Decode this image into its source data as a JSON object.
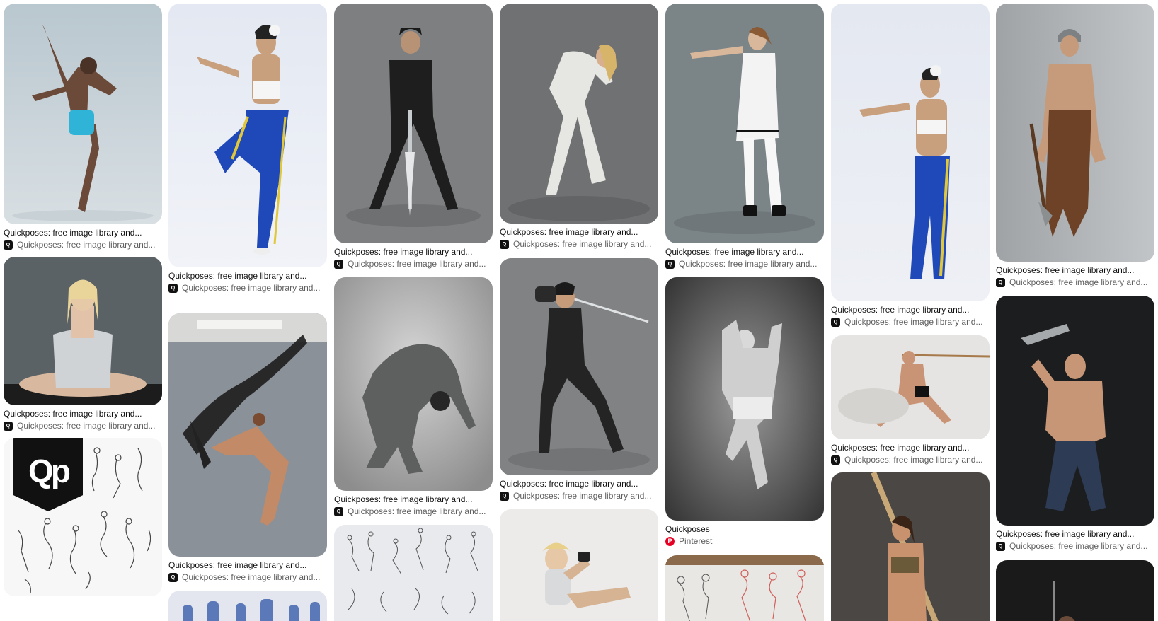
{
  "pins": [
    {
      "title": "Quickposes: free image library and...",
      "source": "Quickposes: free image library and...",
      "source_icon": "quickposes-logo-icon",
      "scene": "gray studio backdrop, man in blue shorts high kick"
    },
    {
      "title": "Quickposes: free image library and...",
      "source": "Quickposes: free image library and...",
      "source_icon": "quickposes-logo-icon",
      "scene": "woman meditating wrapped in towel"
    },
    {
      "title": "",
      "source": "",
      "source_icon": "",
      "scene": "gesture sketches sheet with logo",
      "logo_text": "Qp"
    },
    {
      "title": "Quickposes: free image library and...",
      "source": "Quickposes: free image library and...",
      "source_icon": "quickposes-logo-icon",
      "scene": "woman in blue leggings dancing pose"
    },
    {
      "title": "Quickposes: free image library and...",
      "source": "Quickposes: free image library and...",
      "source_icon": "quickposes-logo-icon",
      "scene": "dancer with black fabric"
    },
    {
      "title": "",
      "source": "",
      "source_icon": "",
      "scene": "blue figure sketches"
    },
    {
      "title": "Quickposes: free image library and...",
      "source": "Quickposes: free image library and...",
      "source_icon": "quickposes-logo-icon",
      "scene": "woman in black armor with sword"
    },
    {
      "title": "Quickposes: free image library and...",
      "source": "Quickposes: free image library and...",
      "source_icon": "quickposes-logo-icon",
      "scene": "man bending backwards"
    },
    {
      "title": "",
      "source": "",
      "source_icon": "",
      "scene": "gesture sketches"
    },
    {
      "title": "Quickposes: free image library and...",
      "source": "Quickposes: free image library and...",
      "source_icon": "quickposes-logo-icon",
      "scene": "woman in white dress bending"
    },
    {
      "title": "Quickposes: free image library and...",
      "source": "Quickposes: free image library and...",
      "source_icon": "quickposes-logo-icon",
      "scene": "woman with sword fighting stance"
    },
    {
      "title": "",
      "source": "",
      "source_icon": "",
      "scene": "blonde woman sitting"
    },
    {
      "title": "Quickposes: free image library and...",
      "source": "Quickposes: free image library and...",
      "source_icon": "quickposes-logo-icon",
      "scene": "girl in white uniform pointing"
    },
    {
      "title": "Quickposes",
      "source": "Pinterest",
      "source_icon": "pinterest-logo-icon",
      "scene": "man jumping black and white"
    },
    {
      "title": "",
      "source": "",
      "source_icon": "",
      "scene": "red and gray sketches"
    },
    {
      "title": "Quickposes: free image library and...",
      "source": "Quickposes: free image library and...",
      "source_icon": "quickposes-logo-icon",
      "scene": "woman reaching forward blue leggings"
    },
    {
      "title": "Quickposes: free image library and...",
      "source": "Quickposes: free image library and...",
      "source_icon": "quickposes-logo-icon",
      "scene": "man lunging with staff"
    },
    {
      "title": "",
      "source": "",
      "source_icon": "",
      "scene": "woman with pole"
    },
    {
      "title": "Quickposes: free image library and...",
      "source": "Quickposes: free image library and...",
      "source_icon": "quickposes-logo-icon",
      "scene": "barbarian with axe"
    },
    {
      "title": "Quickposes: free image library and...",
      "source": "Quickposes: free image library and...",
      "source_icon": "quickposes-logo-icon",
      "scene": "man with wrench dark background"
    },
    {
      "title": "",
      "source": "",
      "source_icon": "",
      "scene": "dark photo"
    }
  ],
  "colors": {
    "title": "#111111",
    "source": "#5f5f5f",
    "pinterest_red": "#e60023"
  }
}
